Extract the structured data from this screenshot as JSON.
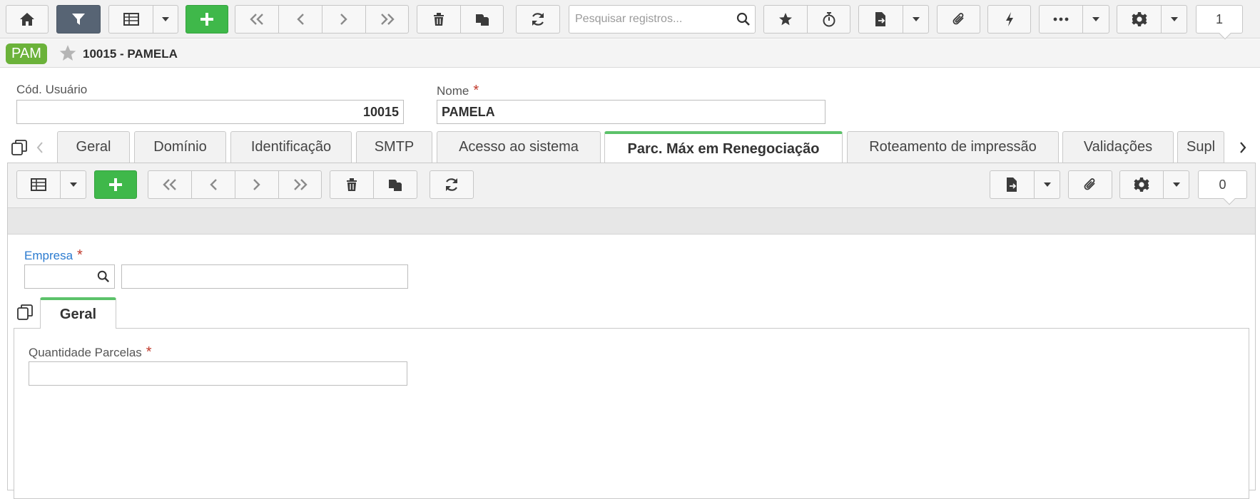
{
  "toolbar": {
    "search_placeholder": "Pesquisar registros...",
    "record_counter": "1"
  },
  "record": {
    "badge": "PAM",
    "title": "10015 - PAMELA"
  },
  "form": {
    "user_code_label": "Cód. Usuário",
    "user_code_value": "10015",
    "name_label": "Nome",
    "name_value": "PAMELA",
    "required_mark": "*"
  },
  "tabs": [
    {
      "label": "Geral"
    },
    {
      "label": "Domínio"
    },
    {
      "label": "Identificação"
    },
    {
      "label": "SMTP"
    },
    {
      "label": "Acesso ao sistema"
    },
    {
      "label": "Parc. Máx em Renegociação",
      "active": true
    },
    {
      "label": "Roteamento de impressão"
    },
    {
      "label": "Validações"
    },
    {
      "label": "Supl"
    }
  ],
  "detail": {
    "record_counter": "0",
    "empresa_label": "Empresa",
    "empresa_code": "",
    "empresa_name": "",
    "subtab_label": "Geral",
    "quantity_label": "Quantidade Parcelas",
    "quantity_value": ""
  },
  "colors": {
    "accent_green": "#3fb84a",
    "tab_active_border": "#5cc26a",
    "badge": "#6bb23a",
    "filter_button": "#576474",
    "required": "#c0392b",
    "link_label": "#2b7bd0"
  }
}
